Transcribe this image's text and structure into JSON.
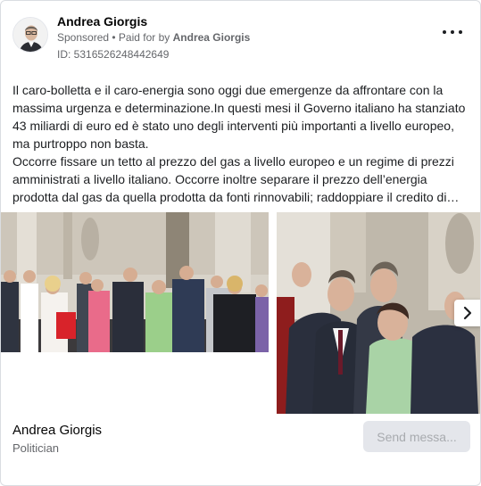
{
  "post": {
    "author": "Andrea Giorgis",
    "sponsored_label": "Sponsored",
    "paid_for_prefix": " • Paid for by ",
    "paid_for_name": "Andrea Giorgis",
    "ad_id": "ID: 5316526248442649",
    "menu_icon": "more-horizontal-icon",
    "body_lines": [
      "Il caro-bolletta e il caro-energia sono oggi due emergenze da affrontare con la",
      "massima urgenza e determinazione.In questi mesi il Governo italiano ha stanziato",
      "43 miliardi di euro ed è stato uno degli interventi più importanti a livello europeo,",
      "ma purtroppo non basta.",
      "Occorre fissare un tetto al prezzo del gas a livello europeo e un regime di prezzi",
      "amministrati a livello italiano. Occorre inoltre separare il prezzo dell’energia",
      "prodotta dal gas da quella prodotta da fonti rinnovabili; raddoppiare il credito di…"
    ]
  },
  "carousel": {
    "next_icon": "chevron-right-icon"
  },
  "footer": {
    "page_name": "Andrea Giorgis",
    "page_category": "Politician",
    "send_button_label": "Send messa..."
  }
}
